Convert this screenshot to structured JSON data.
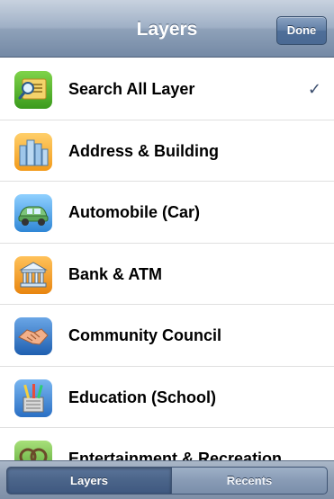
{
  "navbar": {
    "title": "Layers",
    "done_label": "Done"
  },
  "list": {
    "items": [
      {
        "label": "Search All Layer",
        "icon": "search-layer-icon",
        "checked": true
      },
      {
        "label": "Address & Building",
        "icon": "building-icon"
      },
      {
        "label": "Automobile (Car)",
        "icon": "car-icon"
      },
      {
        "label": "Bank & ATM",
        "icon": "bank-icon"
      },
      {
        "label": "Community Council",
        "icon": "handshake-icon"
      },
      {
        "label": "Education (School)",
        "icon": "education-icon"
      },
      {
        "label": "Entertainment & Recreation",
        "icon": "entertainment-icon"
      }
    ],
    "checkmark": "✓"
  },
  "tabbar": {
    "tabs": [
      {
        "label": "Layers",
        "selected": true
      },
      {
        "label": "Recents",
        "selected": false
      }
    ]
  }
}
